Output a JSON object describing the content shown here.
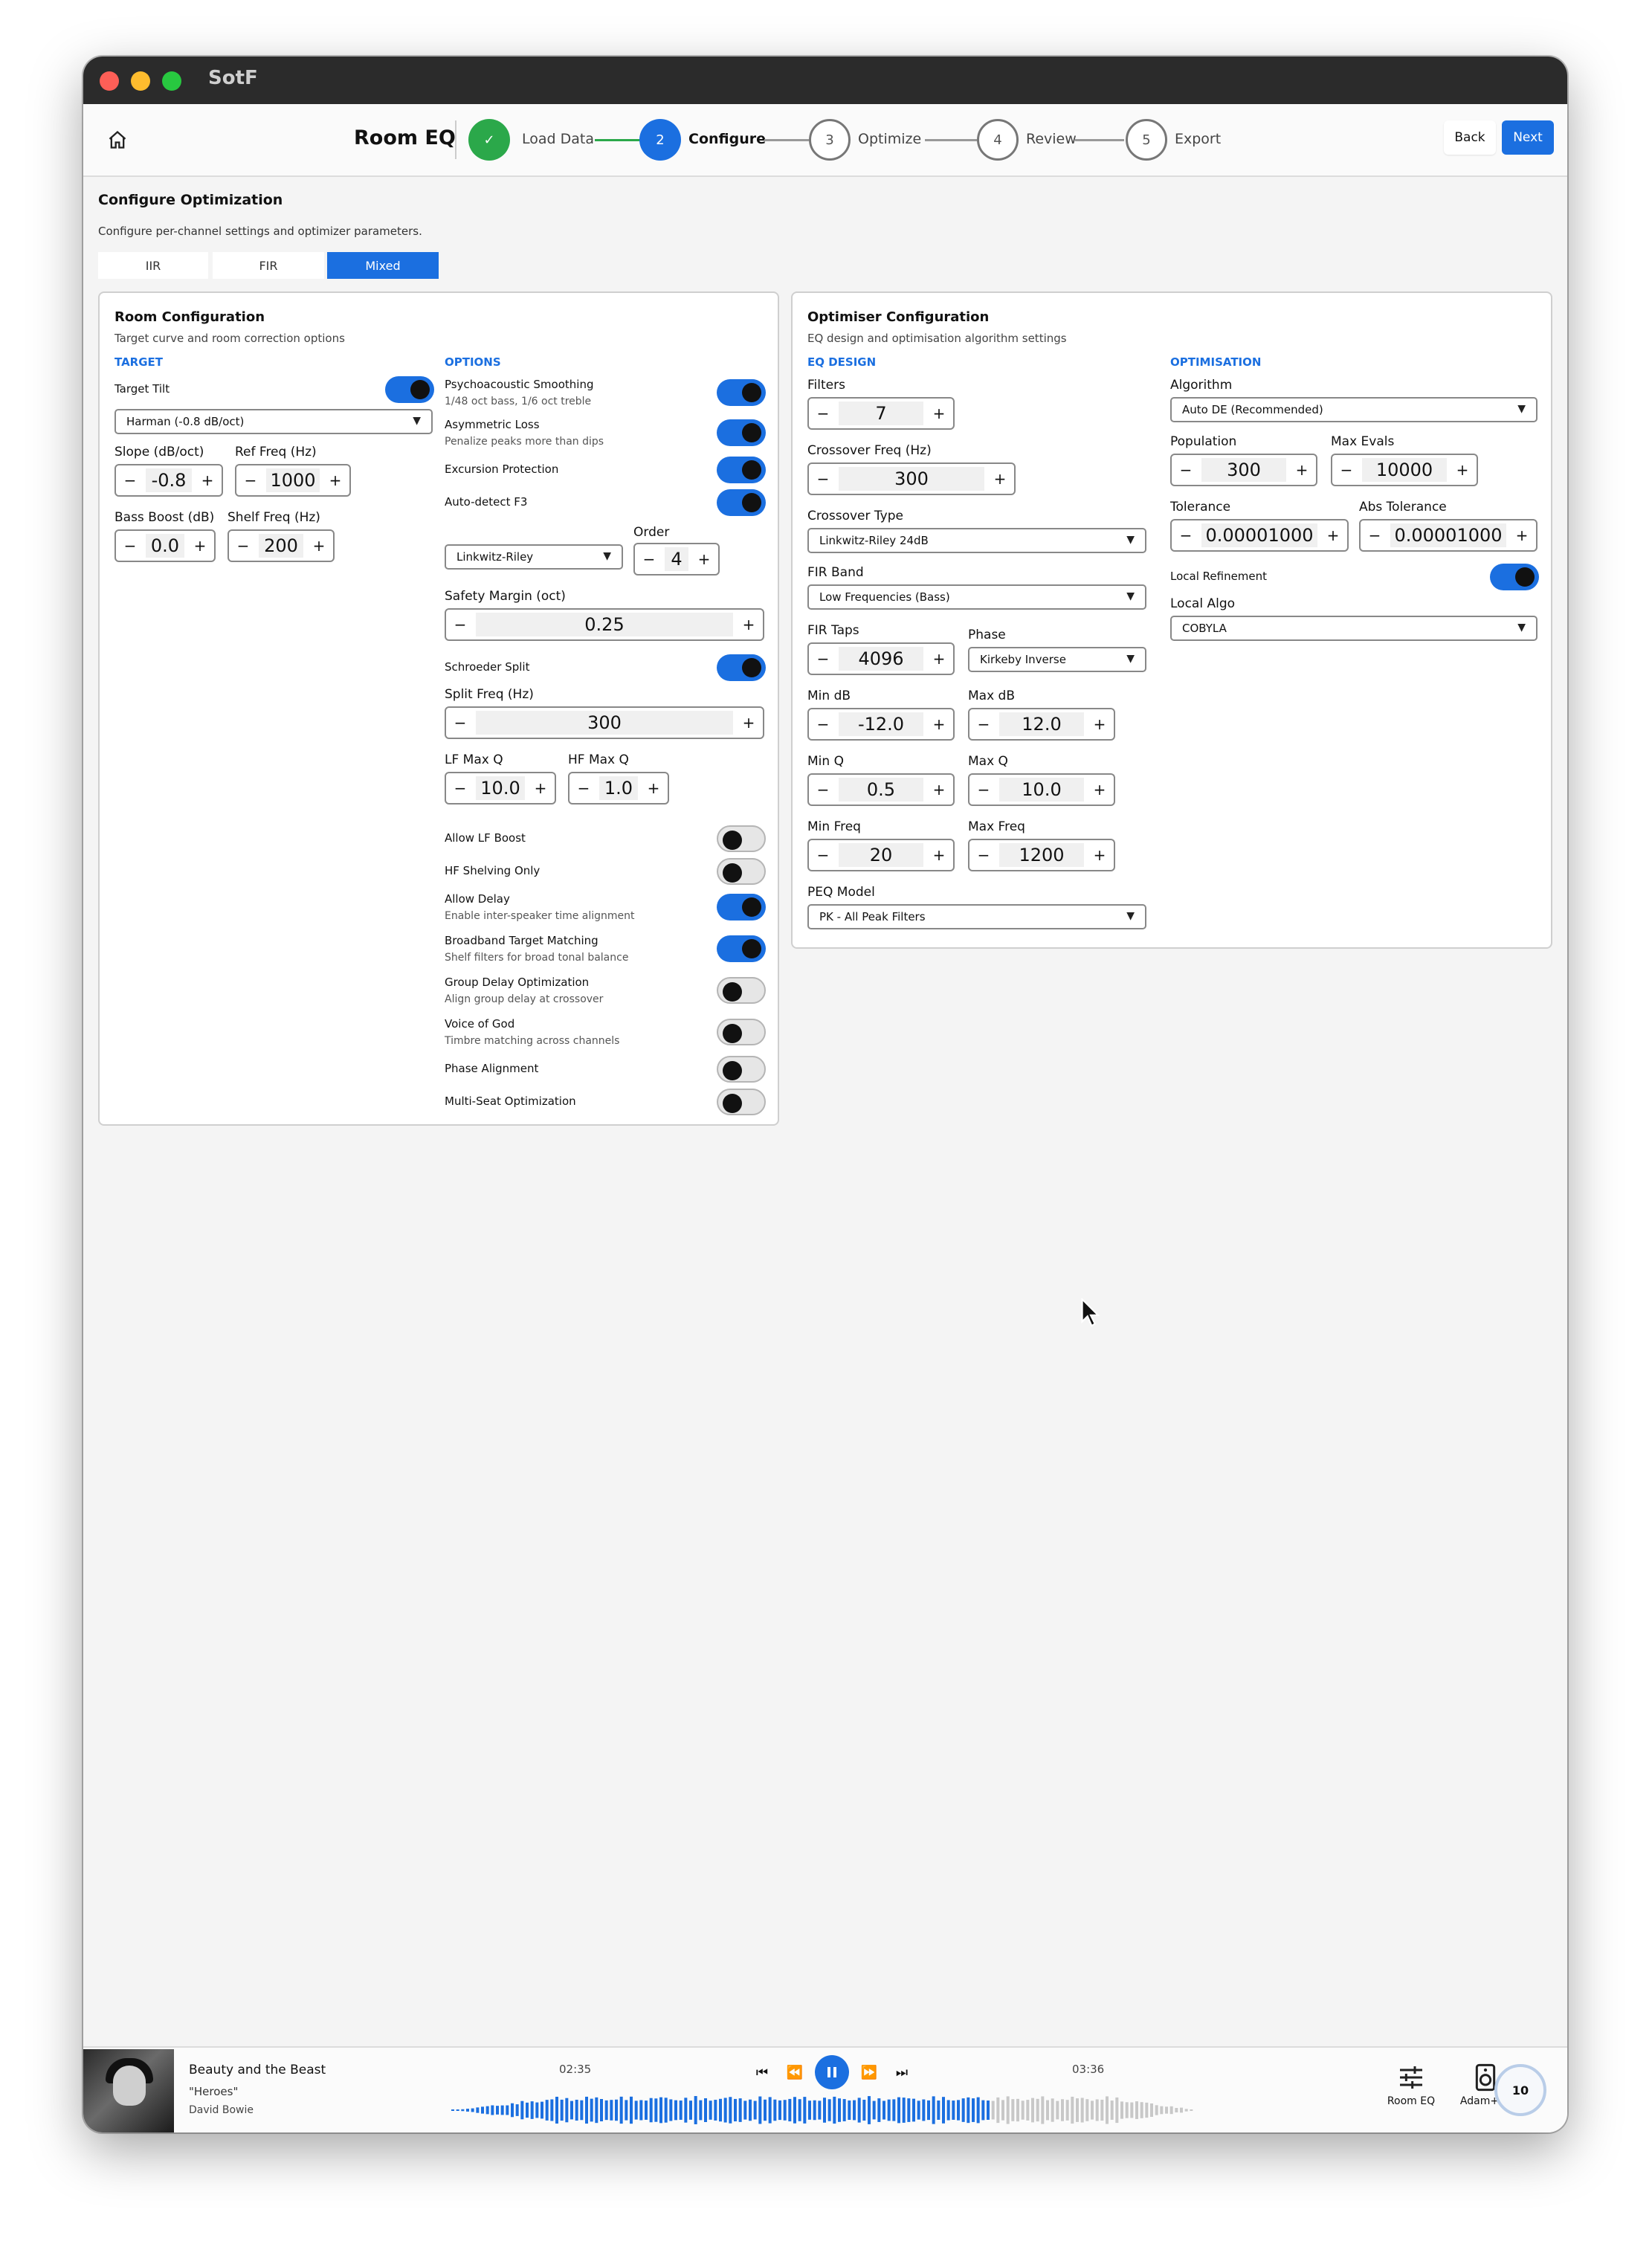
{
  "window": {
    "app_title": "SotF"
  },
  "header": {
    "page_name": "Room EQ",
    "steps": [
      {
        "number": "✓",
        "label": "Load Data",
        "state": "done"
      },
      {
        "number": "2",
        "label": "Configure",
        "state": "active"
      },
      {
        "number": "3",
        "label": "Optimize",
        "state": "todo"
      },
      {
        "number": "4",
        "label": "Review",
        "state": "todo"
      },
      {
        "number": "5",
        "label": "Export",
        "state": "todo"
      }
    ],
    "back_label": "Back",
    "next_label": "Next"
  },
  "page": {
    "title": "Configure Optimization",
    "subtitle": "Configure per-channel settings and optimizer parameters.",
    "tabs": [
      {
        "label": "IIR",
        "active": false
      },
      {
        "label": "FIR",
        "active": false
      },
      {
        "label": "Mixed",
        "active": true
      }
    ]
  },
  "room": {
    "title": "Room Configuration",
    "subtitle": "Target curve and room correction options",
    "target_heading": "TARGET",
    "target_tilt_label": "Target Tilt",
    "target_tilt_on": true,
    "target_select": "Harman (-0.8 dB/oct)",
    "slope_label": "Slope (dB/oct)",
    "slope_value": "-0.8",
    "ref_freq_label": "Ref Freq (Hz)",
    "ref_freq_value": "1000",
    "bass_boost_label": "Bass Boost (dB)",
    "bass_boost_value": "0.0",
    "shelf_freq_label": "Shelf Freq (Hz)",
    "shelf_freq_value": "200",
    "options_heading": "OPTIONS",
    "psycho_label": "Psychoacoustic Smoothing",
    "psycho_desc": "1/48 oct bass, 1/6 oct treble",
    "asym_label": "Asymmetric Loss",
    "asym_desc": "Penalize peaks more than dips",
    "excursion_label": "Excursion Protection",
    "autodetect_label": "Auto-detect F3",
    "filter_type_select": "Linkwitz-Riley",
    "order_label": "Order",
    "order_value": "4",
    "safety_label": "Safety Margin (oct)",
    "safety_value": "0.25",
    "schroeder_label": "Schroeder Split",
    "split_freq_label": "Split Freq (Hz)",
    "split_freq_value": "300",
    "lf_max_q_label": "LF Max Q",
    "lf_max_q_value": "10.0",
    "hf_max_q_label": "HF Max Q",
    "hf_max_q_value": "1.0",
    "allow_lf_boost_label": "Allow LF Boost",
    "hf_shelving_label": "HF Shelving Only",
    "allow_delay_label": "Allow Delay",
    "allow_delay_desc": "Enable inter-speaker time alignment",
    "broadband_label": "Broadband Target Matching",
    "broadband_desc": "Shelf filters for broad tonal balance",
    "group_delay_label": "Group Delay Optimization",
    "group_delay_desc": "Align group delay at crossover",
    "voice_label": "Voice of God",
    "voice_desc": "Timbre matching across channels",
    "phase_align_label": "Phase Alignment",
    "multiseat_label": "Multi-Seat Optimization"
  },
  "optimiser": {
    "title": "Optimiser Configuration",
    "subtitle": "EQ design and optimisation algorithm settings",
    "eq_heading": "EQ DESIGN",
    "filters_label": "Filters",
    "filters_value": "7",
    "crossover_freq_label": "Crossover Freq (Hz)",
    "crossover_freq_value": "300",
    "crossover_type_label": "Crossover Type",
    "crossover_type_select": "Linkwitz-Riley 24dB",
    "fir_band_label": "FIR Band",
    "fir_band_select": "Low Frequencies (Bass)",
    "fir_taps_label": "FIR Taps",
    "fir_taps_value": "4096",
    "phase_label": "Phase",
    "phase_select": "Kirkeby Inverse",
    "min_db_label": "Min dB",
    "min_db_value": "-12.0",
    "max_db_label": "Max dB",
    "max_db_value": "12.0",
    "min_q_label": "Min Q",
    "min_q_value": "0.5",
    "max_q_label": "Max Q",
    "max_q_value": "10.0",
    "min_freq_label": "Min Freq",
    "min_freq_value": "20",
    "max_freq_label": "Max Freq",
    "max_freq_value": "1200",
    "peq_model_label": "PEQ Model",
    "peq_model_select": "PK - All Peak Filters",
    "opt_heading": "OPTIMISATION",
    "algorithm_label": "Algorithm",
    "algorithm_select": "Auto DE (Recommended)",
    "population_label": "Population",
    "population_value": "300",
    "max_evals_label": "Max Evals",
    "max_evals_value": "10000",
    "tolerance_label": "Tolerance",
    "tolerance_value": "0.00001000",
    "abs_tolerance_label": "Abs Tolerance",
    "abs_tolerance_value": "0.00001000",
    "local_refinement_label": "Local Refinement",
    "local_algo_label": "Local Algo",
    "local_algo_select": "COBYLA"
  },
  "player": {
    "track_title": "Beauty and the Beast",
    "album": "\"Heroes\"",
    "artist": "David Bowie",
    "elapsed": "02:35",
    "duration": "03:36",
    "progress": 0.72,
    "room_eq_label": "Room EQ",
    "device_label": "Adam+Mi",
    "volume": "10"
  },
  "colors": {
    "accent": "#1b6fe0",
    "done": "#2ba84a"
  }
}
